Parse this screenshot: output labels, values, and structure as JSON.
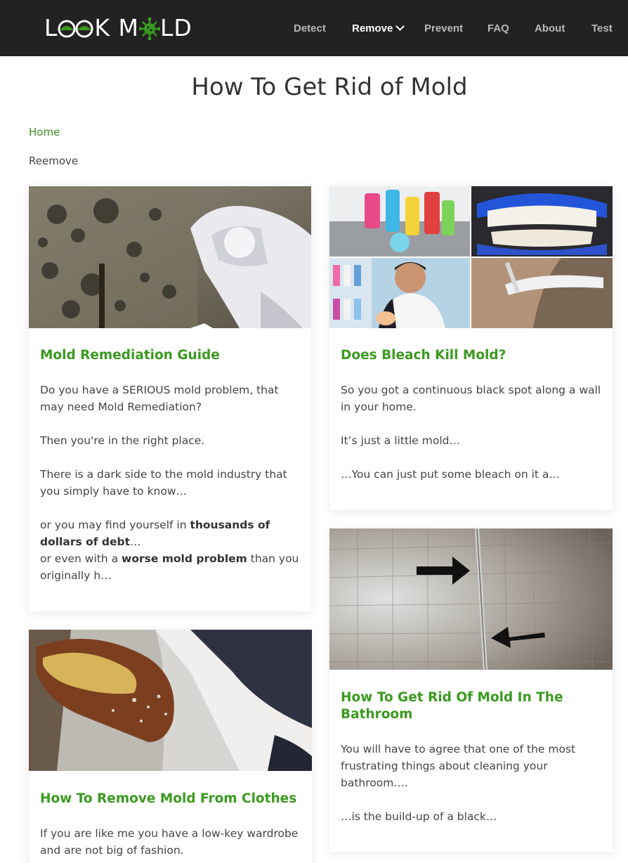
{
  "brand": {
    "logo_text_left": "L",
    "logo_text_mid": "K M",
    "logo_text_right": "LD",
    "accent": "#3a9a1f",
    "header_bg": "#222222"
  },
  "nav": {
    "items": [
      {
        "label": "Detect"
      },
      {
        "label": "Remove"
      },
      {
        "label": "Prevent"
      },
      {
        "label": "FAQ"
      },
      {
        "label": "About"
      },
      {
        "label": "Test"
      }
    ]
  },
  "page": {
    "title": "How To Get Rid of Mold"
  },
  "breadcrumb": {
    "home": "Home",
    "current": "Reemove"
  },
  "cards": [
    {
      "title": "Mold Remediation Guide",
      "p1": "Do you have a SERIOUS mold problem, that may need Mold Remediation?",
      "p2": "Then you're in the right place.",
      "p3": "There is a dark side to the mold industry that you simply have to know…",
      "p4_a": "or you may find yourself in ",
      "p4_b": "thousands of dollars of debt",
      "p4_c": "…",
      "p5_a": "or even with a ",
      "p5_b": "worse mold problem",
      "p5_c": " than you originally h…"
    },
    {
      "title": "Does Bleach Kill Mold?",
      "p1": "So you got a continuous black spot along a wall in your home.",
      "p2": "It’s just a little mold…",
      "p3": "…You can just put some bleach on it a…"
    },
    {
      "title": "How To Get Rid Of Mold In The Bathroom",
      "p1": "You will have to agree that one of the most frustrating things about cleaning your bathroom….",
      "p2": "…is the build-up of a black…"
    },
    {
      "title": "How To Remove Mold From Clothes",
      "p1": "If you are like me you have a low-key wardrobe and are not big of fashion."
    }
  ]
}
